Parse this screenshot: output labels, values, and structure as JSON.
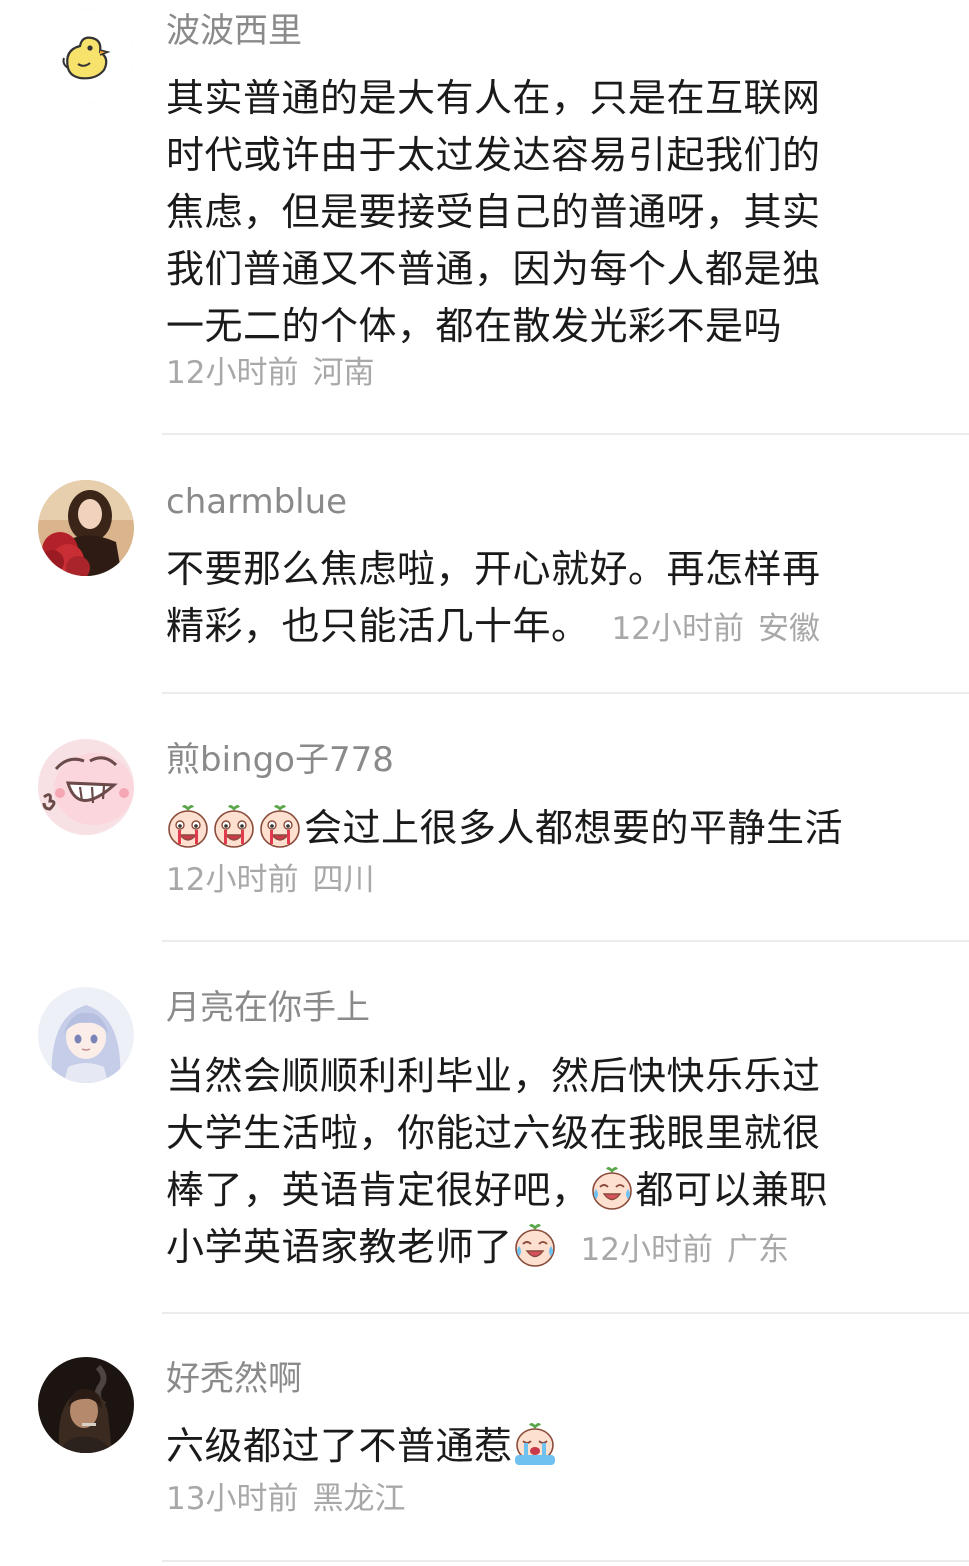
{
  "comments": [
    {
      "username": "波波西里",
      "lines": [
        "其实普通的是大有人在，只是在互联网",
        "时代或许由于太过发达容易引起我们的",
        "焦虑，但是要接受自己的普通呀，其实",
        "我们普通又不普通，因为每个人都是独",
        "一无二的个体，都在散发光彩不是吗"
      ],
      "time": "12小时前",
      "location": "河南",
      "avatar_icon": "yellow-chick-icon"
    },
    {
      "username": "charmblue",
      "lines": [
        "不要那么焦虑啦，开心就好。再怎样再",
        "精彩，也只能活几十年。"
      ],
      "time": "12小时前",
      "location": "安徽",
      "avatar_icon": "woman-with-roses-photo"
    },
    {
      "username": "煎bingo子778",
      "lines": [
        "会过上很多人都想要的平静生活"
      ],
      "time": "12小时前",
      "location": "四川",
      "avatar_icon": "grinning-pink-face-icon",
      "emoji_icon": "crying-peach-emoji"
    },
    {
      "username": "月亮在你手上",
      "lines": [
        "当然会顺顺利利毕业，然后快快乐乐过",
        "大学生活啦，你能过六级在我眼里就很",
        "棒了，英语肯定很好吧，",
        "都可以兼职",
        "小学英语家教老师了"
      ],
      "time": "12小时前",
      "location": "广东",
      "avatar_icon": "anime-girl-avatar",
      "emoji_icon": "laughing-tears-peach-emoji"
    },
    {
      "username": "好秃然啊",
      "lines": [
        "六级都过了不普通惹"
      ],
      "time": "13小时前",
      "location": "黑龙江",
      "avatar_icon": "smoking-woman-photo",
      "emoji_icon": "bawling-peach-emoji"
    }
  ],
  "colors": {
    "username": "#8a8a8a",
    "body": "#1a1a1a",
    "meta": "#a8a8a8",
    "divider": "#ececec"
  }
}
